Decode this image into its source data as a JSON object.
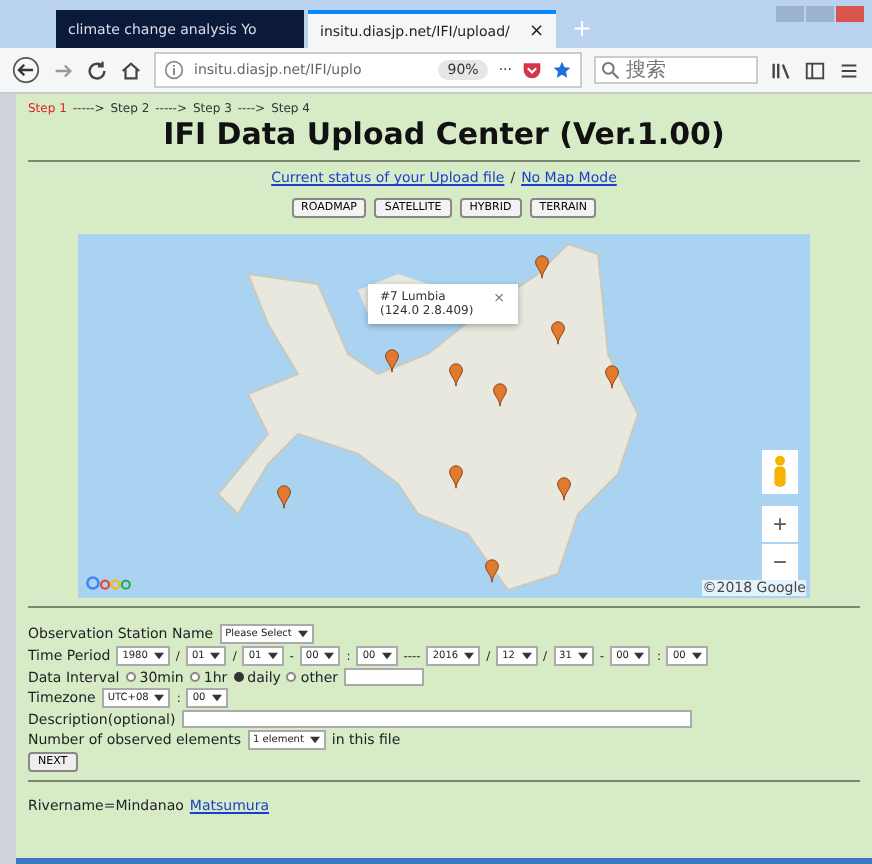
{
  "browser": {
    "tabs": [
      {
        "title": "climate change analysis Yo",
        "selected": false
      },
      {
        "title": "insitu.diasjp.net/IFI/upload/",
        "selected": true
      }
    ],
    "tab_close": "×",
    "new_tab": "+",
    "url": "insitu.diasjp.net/IFI/uplo",
    "zoom": "90%",
    "more": "···",
    "search": {
      "placeholder": "搜索"
    }
  },
  "steps": [
    {
      "label": "Step 1",
      "selected": true,
      "separator": "----->"
    },
    {
      "label": "Step 2",
      "selected": false,
      "separator": "----->"
    },
    {
      "label": "Step 3",
      "selected": false,
      "separator": "---->"
    },
    {
      "label": "Step 4",
      "selected": false
    }
  ],
  "title": "IFI Data Upload Center (Ver.1.00)",
  "links": [
    {
      "text": "Current status of your Upload file"
    },
    {
      "text": "No Map Mode"
    }
  ],
  "link_separator": "/",
  "map_types": [
    {
      "label": "ROADMAP"
    },
    {
      "label": "SATELLITE"
    },
    {
      "label": "HYBRID"
    },
    {
      "label": "TERRAIN"
    }
  ],
  "map": {
    "popup": {
      "title": "#7 Lumbia",
      "coords": "(124.0 2.8.409)",
      "close": "×"
    },
    "zoom_in": "+",
    "zoom_out": "−",
    "attribution": "©2018 Google"
  },
  "form": [
    {
      "items": [
        {
          "kind": "label",
          "text": "Observation Station Name"
        },
        {
          "kind": "select",
          "text": "Please Select"
        }
      ]
    },
    {
      "items": [
        {
          "kind": "label",
          "text": "Time Period"
        },
        {
          "kind": "select",
          "text": "1980"
        },
        {
          "kind": "sep",
          "text": "/"
        },
        {
          "kind": "select",
          "text": "01"
        },
        {
          "kind": "sep",
          "text": "/"
        },
        {
          "kind": "select",
          "text": "01"
        },
        {
          "kind": "sep",
          "text": "-"
        },
        {
          "kind": "select",
          "text": "00"
        },
        {
          "kind": "sep",
          "text": ":"
        },
        {
          "kind": "select",
          "text": "00"
        },
        {
          "kind": "sep",
          "text": "----"
        },
        {
          "kind": "select",
          "text": "2016"
        },
        {
          "kind": "sep",
          "text": "/"
        },
        {
          "kind": "select",
          "text": "12"
        },
        {
          "kind": "sep",
          "text": "/"
        },
        {
          "kind": "select",
          "text": "31"
        },
        {
          "kind": "sep",
          "text": "-"
        },
        {
          "kind": "select",
          "text": "00"
        },
        {
          "kind": "sep",
          "text": ":"
        },
        {
          "kind": "select",
          "text": "00"
        }
      ]
    },
    {
      "items": [
        {
          "kind": "label",
          "text": "Data Interval"
        },
        {
          "kind": "radio",
          "text": "30min",
          "selected": false
        },
        {
          "kind": "radio",
          "text": "1hr",
          "selected": false
        },
        {
          "kind": "radio",
          "text": "daily",
          "selected": true
        },
        {
          "kind": "radio",
          "text": "other",
          "selected": false
        },
        {
          "kind": "input"
        }
      ]
    },
    {
      "items": [
        {
          "kind": "label",
          "text": "Timezone"
        },
        {
          "kind": "select",
          "text": "UTC+08"
        },
        {
          "kind": "sep",
          "text": ":"
        },
        {
          "kind": "select",
          "text": "00"
        }
      ]
    },
    {
      "items": [
        {
          "kind": "label",
          "text": "Description(optional)"
        },
        {
          "kind": "wideinput"
        }
      ]
    },
    {
      "items": [
        {
          "kind": "label",
          "text": "Number of observed elements"
        },
        {
          "kind": "select",
          "text": "1 element"
        },
        {
          "kind": "label",
          "text": "in this file"
        }
      ]
    },
    {
      "items": [
        {
          "kind": "button",
          "text": "NEXT"
        }
      ]
    }
  ],
  "footer": {
    "text": "Rivername=Mindanao",
    "link": "Matsumura"
  }
}
